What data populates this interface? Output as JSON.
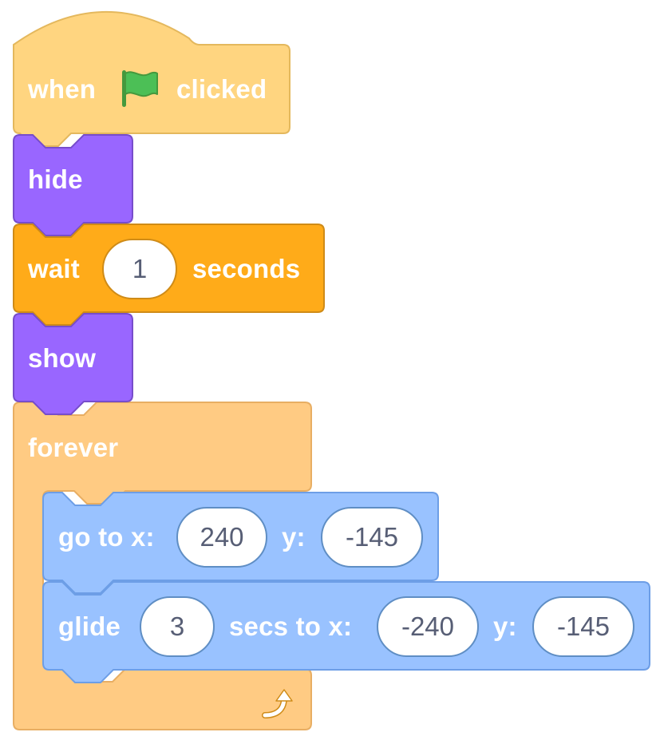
{
  "script": {
    "hat": {
      "prefix": "when",
      "icon": "green-flag-icon",
      "suffix": "clicked"
    },
    "hide": {
      "label": "hide"
    },
    "wait": {
      "label_start": "wait",
      "seconds_value": "1",
      "label_end": "seconds"
    },
    "show": {
      "label": "show"
    },
    "forever": {
      "label": "forever",
      "icon": "loop-arrow-icon"
    },
    "goto": {
      "label_x": "go to x:",
      "x_value": "240",
      "label_y": "y:",
      "y_value": "-145"
    },
    "glide": {
      "label_start": "glide",
      "secs_value": "3",
      "label_mid": "secs to x:",
      "x_value": "-240",
      "label_y": "y:",
      "y_value": "-145"
    }
  },
  "colors": {
    "events": "#ffd580",
    "events_border": "#e4b85d",
    "looks": "#9966ff",
    "looks_border": "#774dcb",
    "control": "#ffab19",
    "control_border": "#cf8b17",
    "control_c": "#ffcb83",
    "control_c_border": "#e8ae63",
    "motion": "#99c2ff",
    "motion_border": "#6d9ee6",
    "flag_green": "#4cbf56"
  }
}
